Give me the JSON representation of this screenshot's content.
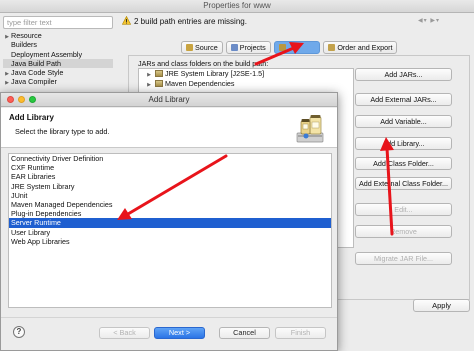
{
  "properties_window": {
    "title": "Properties for www",
    "filter_placeholder": "type filter text",
    "nav_items": [
      {
        "label": "Resource",
        "expandable": true
      },
      {
        "label": "Builders",
        "expandable": false
      },
      {
        "label": "Deployment Assembly",
        "expandable": false
      },
      {
        "label": "Java Build Path",
        "expandable": false,
        "selected": true
      },
      {
        "label": "Java Code Style",
        "expandable": true
      },
      {
        "label": "Java Compiler",
        "expandable": true
      }
    ],
    "status_message": "2 build path entries are missing.",
    "tabs": [
      {
        "label": "Source",
        "icon": "source-folder-icon"
      },
      {
        "label": "Projects",
        "icon": "projects-icon"
      },
      {
        "label": "Libraries",
        "icon": "libraries-icon",
        "active": true
      },
      {
        "label": "Order and Export",
        "icon": "order-export-icon"
      }
    ],
    "jars_label": "JARs and class folders on the build path:",
    "build_path_entries": [
      "JRE System Library [J2SE-1.5]",
      "Maven Dependencies"
    ],
    "side_buttons": [
      {
        "label": "Add JARs...",
        "enabled": true
      },
      {
        "label": "Add External JARs...",
        "enabled": true
      },
      {
        "label": "Add Variable...",
        "enabled": true
      },
      {
        "label": "Add Library...",
        "enabled": true
      },
      {
        "label": "Add Class Folder...",
        "enabled": true
      },
      {
        "label": "Add External Class Folder...",
        "enabled": true
      },
      {
        "label": "Edit...",
        "enabled": false
      },
      {
        "label": "Remove",
        "enabled": false
      },
      {
        "label": "Migrate JAR File...",
        "enabled": false
      }
    ],
    "apply_label": "Apply"
  },
  "add_library_dialog": {
    "title": "Add Library",
    "heading": "Add Library",
    "subtitle": "Select the library type to add.",
    "library_types": [
      "Connectivity Driver Definition",
      "CXF Runtime",
      "EAR Libraries",
      "JRE System Library",
      "JUnit",
      "Maven Managed Dependencies",
      "Plug-in Dependencies",
      "Server Runtime",
      "User Library",
      "Web App Libraries"
    ],
    "selected_library": "Server Runtime",
    "buttons": {
      "help": "?",
      "back": "< Back",
      "next": "Next >",
      "cancel": "Cancel",
      "finish": "Finish"
    }
  },
  "colors": {
    "selection_blue": "#1f5fd0",
    "annotation_red": "#e8141b",
    "active_tab_blue": "#6fa9ea",
    "next_button_blue": "#2b74e6"
  }
}
